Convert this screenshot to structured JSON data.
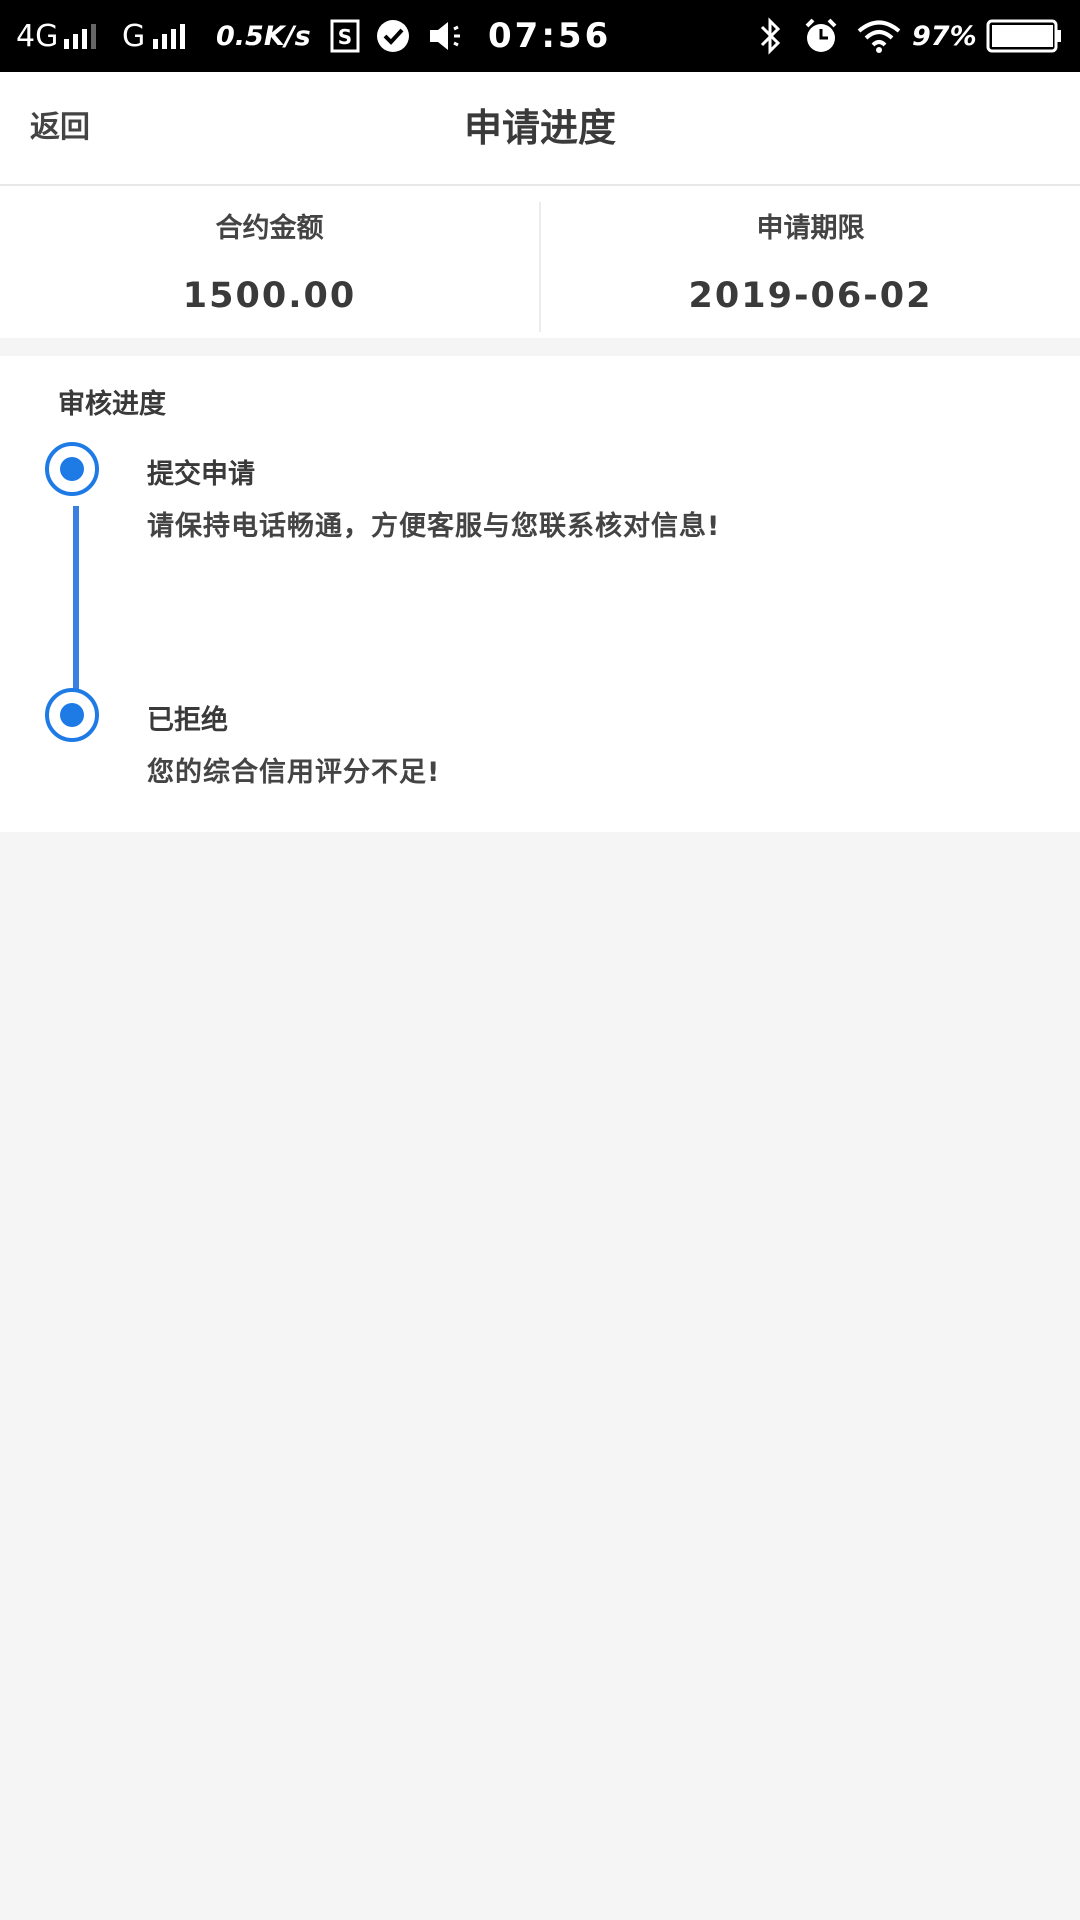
{
  "status_bar": {
    "network1": "4G",
    "network2": "G",
    "speed": "0.5K/s",
    "time": "07:56",
    "battery": "97%"
  },
  "nav": {
    "back_label": "返回",
    "title": "申请进度"
  },
  "summary": {
    "amount_label": "合约金额",
    "amount_value": "1500.00",
    "term_label": "申请期限",
    "term_value": "2019-06-02"
  },
  "progress": {
    "title": "审核进度",
    "steps": [
      {
        "title": "提交申请",
        "desc": "请保持电话畅通，方便客服与您联系核对信息!"
      },
      {
        "title": "已拒绝",
        "desc": "您的综合信用评分不足!"
      }
    ]
  },
  "colors": {
    "accent": "#1e7be6",
    "line": "#3b7fe0",
    "background": "#f5f5f5"
  }
}
